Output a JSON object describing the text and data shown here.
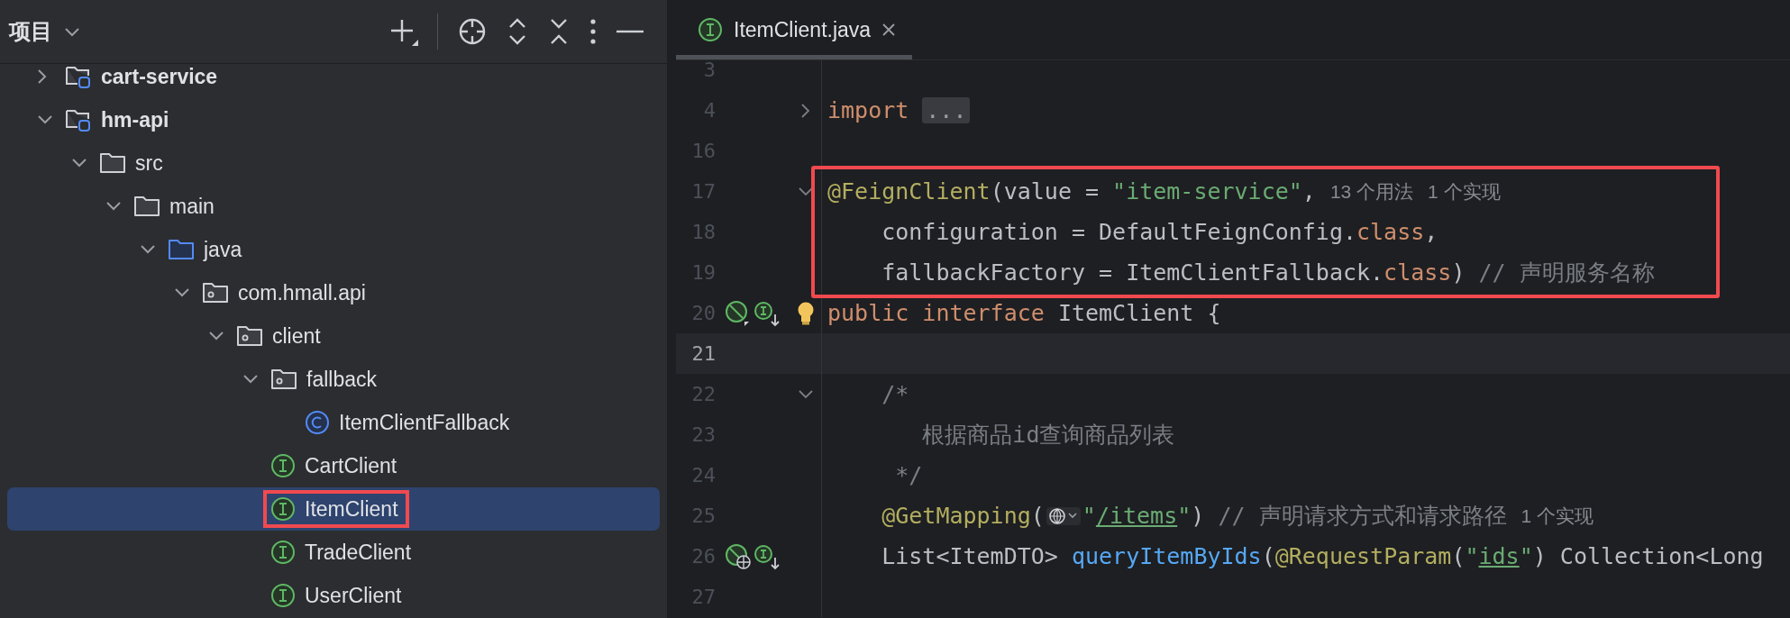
{
  "project_panel": {
    "title": "项目",
    "tree": [
      {
        "name": "cart-service",
        "kind": "module",
        "expanded": false,
        "selected": false,
        "boxed": false
      },
      {
        "name": "hm-api",
        "kind": "module",
        "expanded": true,
        "selected": false,
        "boxed": false,
        "children": [
          {
            "name": "src",
            "kind": "folder",
            "expanded": true,
            "selected": false,
            "boxed": false,
            "children": [
              {
                "name": "main",
                "kind": "folder",
                "expanded": true,
                "selected": false,
                "boxed": false,
                "children": [
                  {
                    "name": "java",
                    "kind": "source",
                    "expanded": true,
                    "selected": false,
                    "boxed": false,
                    "children": [
                      {
                        "name": "com.hmall.api",
                        "kind": "package",
                        "expanded": true,
                        "selected": false,
                        "boxed": false,
                        "children": [
                          {
                            "name": "client",
                            "kind": "package",
                            "expanded": true,
                            "selected": false,
                            "boxed": false,
                            "children": [
                              {
                                "name": "fallback",
                                "kind": "package",
                                "expanded": true,
                                "selected": false,
                                "boxed": false,
                                "children": [
                                  {
                                    "name": "ItemClientFallback",
                                    "kind": "class",
                                    "selected": false,
                                    "boxed": false
                                  }
                                ]
                              },
                              {
                                "name": "CartClient",
                                "kind": "interface",
                                "selected": false,
                                "boxed": false
                              },
                              {
                                "name": "ItemClient",
                                "kind": "interface",
                                "selected": true,
                                "boxed": true
                              },
                              {
                                "name": "TradeClient",
                                "kind": "interface",
                                "selected": false,
                                "boxed": false
                              },
                              {
                                "name": "UserClient",
                                "kind": "interface",
                                "selected": false,
                                "boxed": false
                              }
                            ]
                          }
                        ]
                      }
                    ]
                  }
                ]
              }
            ]
          }
        ]
      }
    ]
  },
  "editor": {
    "tabs": [
      {
        "label": "ItemClient.java",
        "selected": true
      }
    ],
    "lines": [
      {
        "number": "3",
        "current": false,
        "boxed": false
      },
      {
        "number": "4",
        "fold_marker": {
          "expanded": false
        },
        "current": false,
        "boxed": false,
        "tokens": [
          {
            "kind": "keyword",
            "text": "import"
          },
          {
            "kind": "folded",
            "text": "..."
          }
        ]
      },
      {
        "number": "16",
        "current": false,
        "boxed": false
      },
      {
        "number": "17",
        "fold_marker": {
          "expanded": true
        },
        "current": false,
        "boxed": true,
        "tokens": [
          {
            "kind": "annotation",
            "text": "@FeignClient"
          },
          {
            "kind": "plain",
            "text": "(value = "
          },
          {
            "kind": "string",
            "text": "\"item-service\""
          },
          {
            "kind": "plain",
            "text": ","
          },
          {
            "kind": "hint",
            "text": "13 个用法"
          },
          {
            "kind": "hint",
            "text": "1 个实现"
          }
        ]
      },
      {
        "number": "18",
        "current": false,
        "boxed": true,
        "tokens": [
          {
            "kind": "plain",
            "text": "    configuration = DefaultFeignConfig."
          },
          {
            "kind": "keyword",
            "text": "class"
          },
          {
            "kind": "plain",
            "text": ","
          }
        ]
      },
      {
        "number": "19",
        "current": false,
        "boxed": true,
        "tokens": [
          {
            "kind": "plain",
            "text": "    fallbackFactory = ItemClientFallback."
          },
          {
            "kind": "keyword",
            "text": "class"
          },
          {
            "kind": "plain",
            "text": ") "
          },
          {
            "kind": "comment",
            "text": "// 声明服务名称"
          }
        ]
      },
      {
        "number": "20",
        "gutter": [
          {
            "kind": "bean"
          },
          {
            "kind": "implemented"
          },
          {
            "kind": "bulb"
          }
        ],
        "current": false,
        "boxed": false,
        "tokens": [
          {
            "kind": "keyword",
            "text": "public interface"
          },
          {
            "kind": "plain",
            "text": " ItemClient {"
          }
        ]
      },
      {
        "number": "21",
        "current": true,
        "boxed": false
      },
      {
        "number": "22",
        "fold_marker": {
          "expanded": true
        },
        "current": false,
        "boxed": false,
        "tokens": [
          {
            "kind": "comment",
            "text": "    /*"
          }
        ]
      },
      {
        "number": "23",
        "current": false,
        "boxed": false,
        "tokens": [
          {
            "kind": "comment",
            "text": "       根据商品id查询商品列表"
          }
        ]
      },
      {
        "number": "24",
        "current": false,
        "boxed": false,
        "tokens": [
          {
            "kind": "comment",
            "text": "     */"
          }
        ]
      },
      {
        "number": "25",
        "current": false,
        "boxed": false,
        "tokens": [
          {
            "kind": "annotation",
            "text": "    @GetMapping"
          },
          {
            "kind": "plain",
            "text": "("
          },
          {
            "kind": "globe"
          },
          {
            "kind": "string",
            "text": "\""
          },
          {
            "kind": "link",
            "text": "/items"
          },
          {
            "kind": "string",
            "text": "\""
          },
          {
            "kind": "plain",
            "text": ") "
          },
          {
            "kind": "comment",
            "text": "// 声明请求方式和请求路径"
          },
          {
            "kind": "hint",
            "text": "1 个实现"
          }
        ]
      },
      {
        "number": "26",
        "gutter": [
          {
            "kind": "web-bean"
          },
          {
            "kind": "implemented"
          }
        ],
        "current": false,
        "boxed": false,
        "tokens": [
          {
            "kind": "plain",
            "text": "    List<ItemDTO> "
          },
          {
            "kind": "method",
            "text": "queryItemByIds"
          },
          {
            "kind": "plain",
            "text": "("
          },
          {
            "kind": "annotation",
            "text": "@RequestParam"
          },
          {
            "kind": "plain",
            "text": "("
          },
          {
            "kind": "string",
            "text": "\""
          },
          {
            "kind": "link",
            "text": "ids"
          },
          {
            "kind": "string",
            "text": "\""
          },
          {
            "kind": "plain",
            "text": ") Collection<Long"
          }
        ]
      },
      {
        "number": "27",
        "current": false,
        "boxed": false
      }
    ]
  }
}
